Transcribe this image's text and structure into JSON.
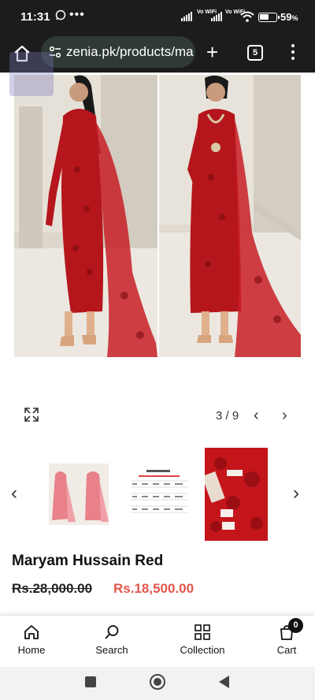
{
  "status_bar": {
    "time": "11:31",
    "battery": "59",
    "battery_unit": "%",
    "vo_wifi": "Vo WiFi",
    "battery_level": 0.59
  },
  "browser": {
    "url": "zenia.pk/products/ma",
    "tab_count": "5"
  },
  "gallery": {
    "counter": "3 / 9",
    "prev": "‹",
    "next": "›"
  },
  "product": {
    "title": "Maryam Hussain Red",
    "old_price": "Rs.28,000.00",
    "new_price": "Rs.18,500.00",
    "accent_color": "#e4564c",
    "dress_color": "#b5161b"
  },
  "bottom_nav": {
    "items": [
      {
        "label": "Home",
        "icon": "home-icon"
      },
      {
        "label": "Search",
        "icon": "search-icon"
      },
      {
        "label": "Collection",
        "icon": "grid-icon"
      },
      {
        "label": "Cart",
        "icon": "shopping-bag-icon"
      }
    ],
    "cart_count": "0"
  }
}
